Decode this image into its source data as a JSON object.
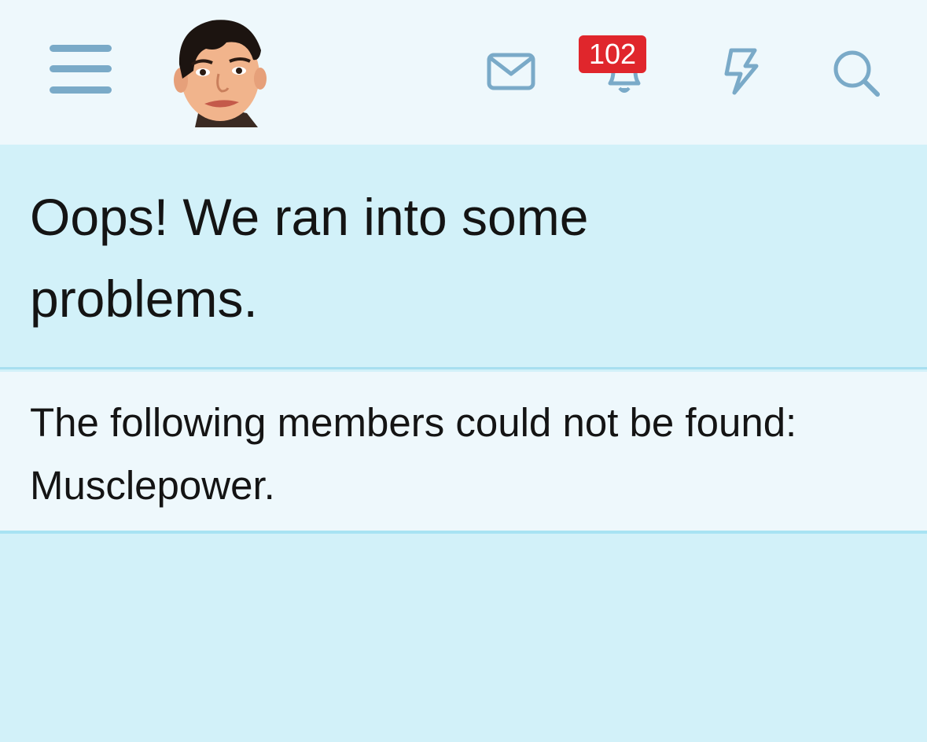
{
  "header": {
    "icons": {
      "menu": "hamburger-menu-icon",
      "mail": "envelope-icon",
      "alerts": "bell-icon",
      "whats_new": "lightning-bolt-icon",
      "search": "magnifier-icon"
    },
    "alerts_badge": "102",
    "icon_color": "#7aaac8",
    "badge_color": "#e0262c"
  },
  "error": {
    "title": "Oops! We ran into some problems.",
    "message": "The following members could not be found: Musclepower."
  }
}
